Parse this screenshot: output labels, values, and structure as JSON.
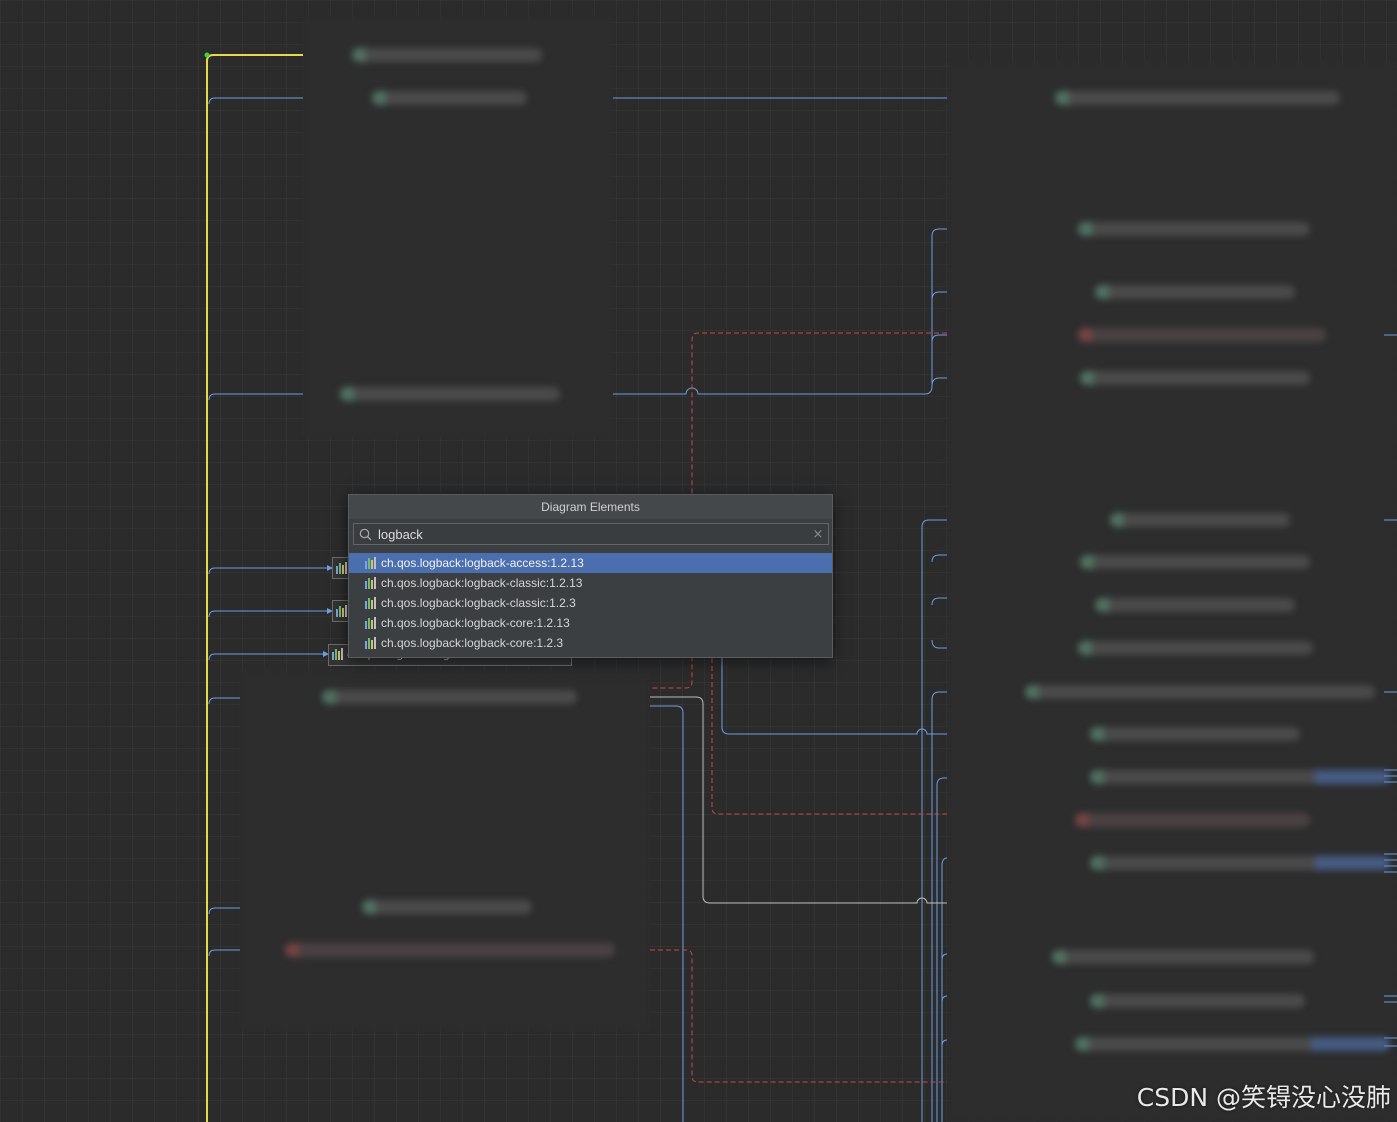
{
  "popup": {
    "title": "Diagram Elements",
    "search": {
      "value": "logback",
      "placeholder": ""
    },
    "results": [
      {
        "label": "ch.qos.logback:logback-access:1.2.13",
        "selected": true
      },
      {
        "label": "ch.qos.logback:logback-classic:1.2.13",
        "selected": false
      },
      {
        "label": "ch.qos.logback:logback-classic:1.2.3",
        "selected": false
      },
      {
        "label": "ch.qos.logback:logback-core:1.2.13",
        "selected": false
      },
      {
        "label": "ch.qos.logback:logback-core:1.2.3",
        "selected": false
      }
    ]
  },
  "partial_node_label": "ch.qos.logback:logback-access:1.2.13",
  "watermark": "CSDN @笑锝没心没肺",
  "colors": {
    "canvas": "#2b2b2b",
    "edge_blue": "#6d9fe0",
    "edge_red_dashed": "#c94848",
    "edge_yellow": "#e6d94a",
    "edge_white": "#bdbdbd",
    "selection": "#4b6eaf"
  }
}
